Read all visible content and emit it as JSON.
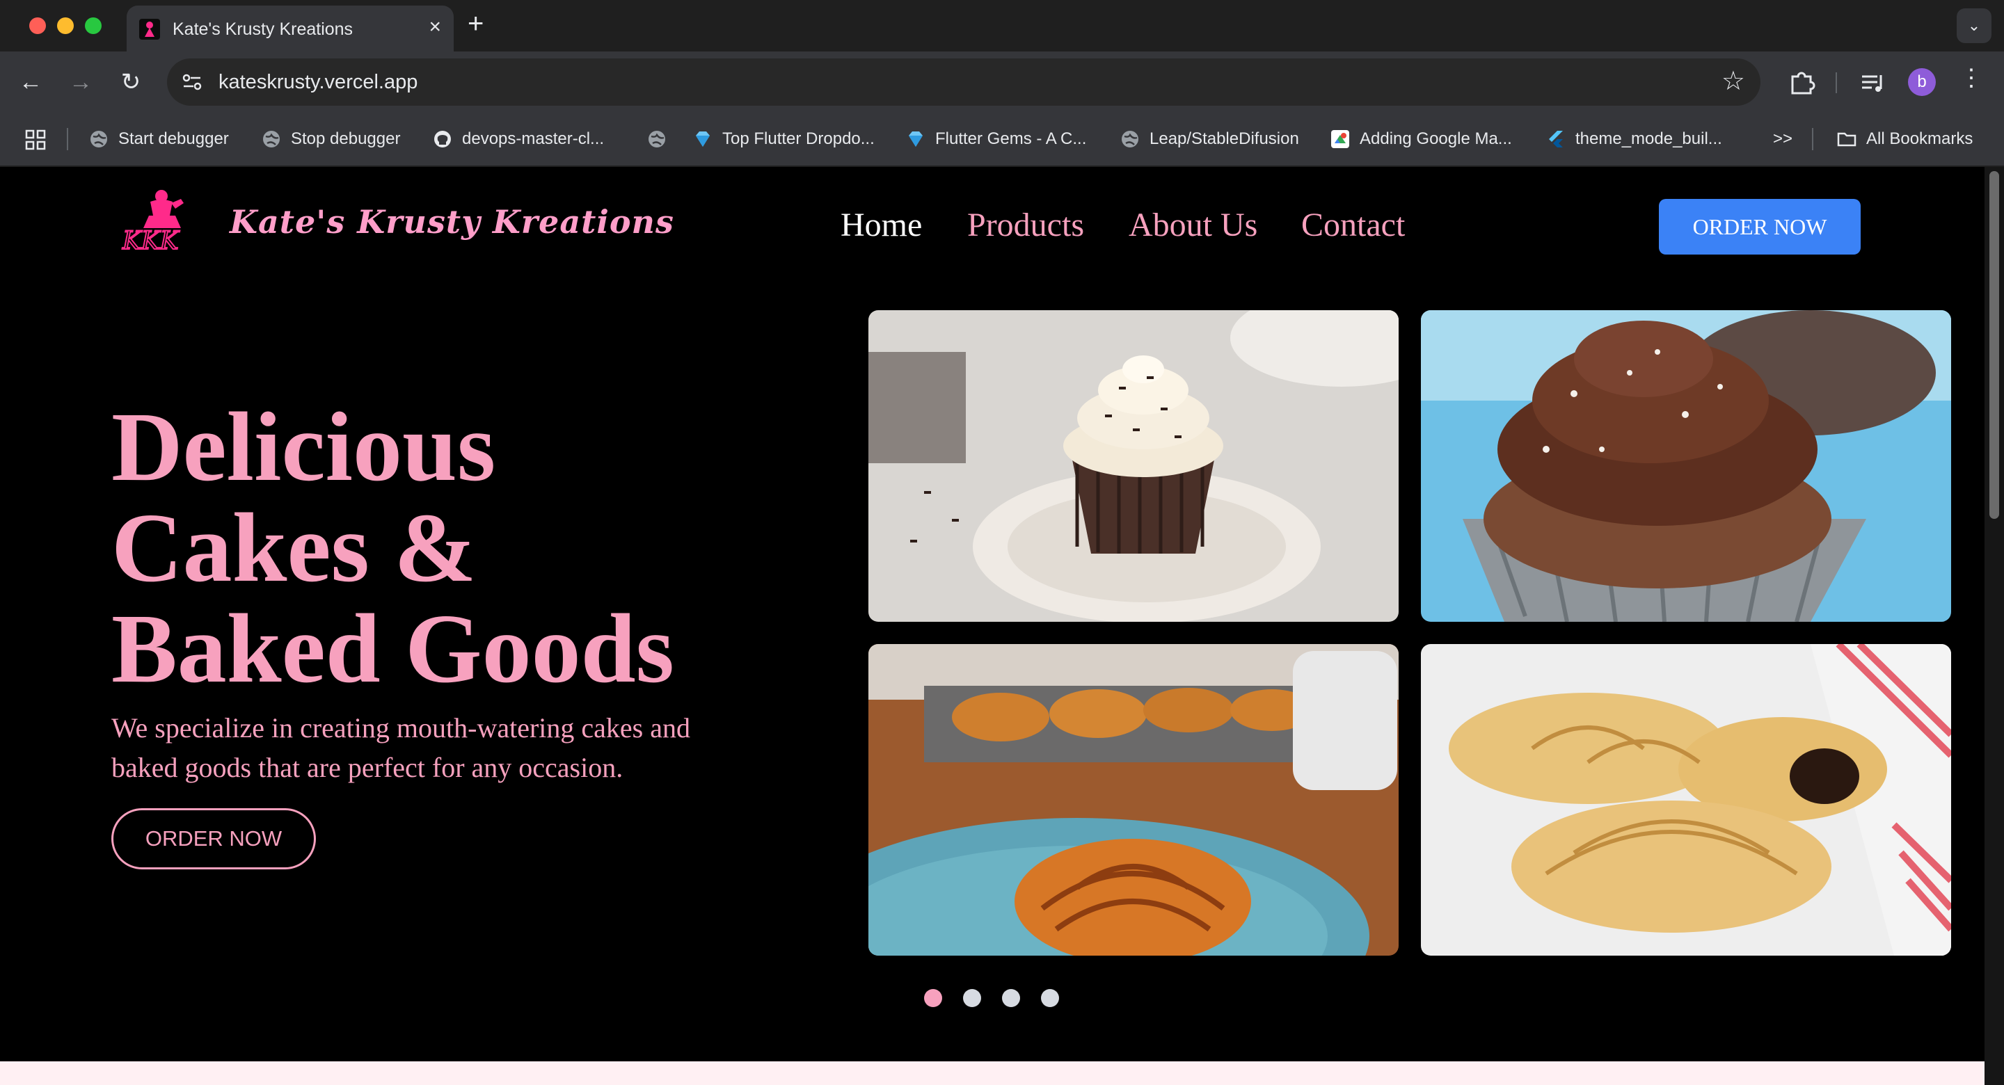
{
  "browser": {
    "tab_title": "Kate's Krusty Kreations",
    "url": "kateskrusty.vercel.app",
    "profile_initial": "b",
    "bookmarks": [
      {
        "label": "Start debugger",
        "icon": "globe-icon"
      },
      {
        "label": "Stop debugger",
        "icon": "globe-icon"
      },
      {
        "label": "devops-master-cl...",
        "icon": "github-icon"
      },
      {
        "label": "",
        "icon": "globe-icon"
      },
      {
        "label": "Top Flutter Dropdo...",
        "icon": "flutter-gems-icon"
      },
      {
        "label": "Flutter Gems - A C...",
        "icon": "flutter-gems-icon"
      },
      {
        "label": "Leap/StableDifusion",
        "icon": "globe-icon"
      },
      {
        "label": "Adding Google Ma...",
        "icon": "google-maps-icon"
      },
      {
        "label": "theme_mode_buil...",
        "icon": "flutter-icon"
      }
    ],
    "all_bookmarks": "All Bookmarks",
    "overflow": ">>"
  },
  "site": {
    "brand_name": "Kate's Krusty Kreations",
    "nav": [
      "Home",
      "Products",
      "About Us",
      "Contact"
    ],
    "order_button_top": "ORDER NOW"
  },
  "hero": {
    "title_lines": [
      "Delicious",
      "Cakes &",
      "Baked Goods"
    ],
    "subtitle": "We specialize in creating mouth-watering cakes and baked goods that are perfect for any occasion.",
    "cta": "ORDER NOW"
  },
  "gallery": {
    "images": [
      "vanilla-frosted-chocolate-cupcake",
      "chocolate-frosted-cupcake",
      "croissant-on-blue-plate",
      "chocolate-filled-croissants"
    ],
    "dots": 4,
    "active_dot": 1
  },
  "colors": {
    "accent_pink": "#f7a1be",
    "button_blue": "#3b82f6",
    "page_background": "#000000"
  }
}
